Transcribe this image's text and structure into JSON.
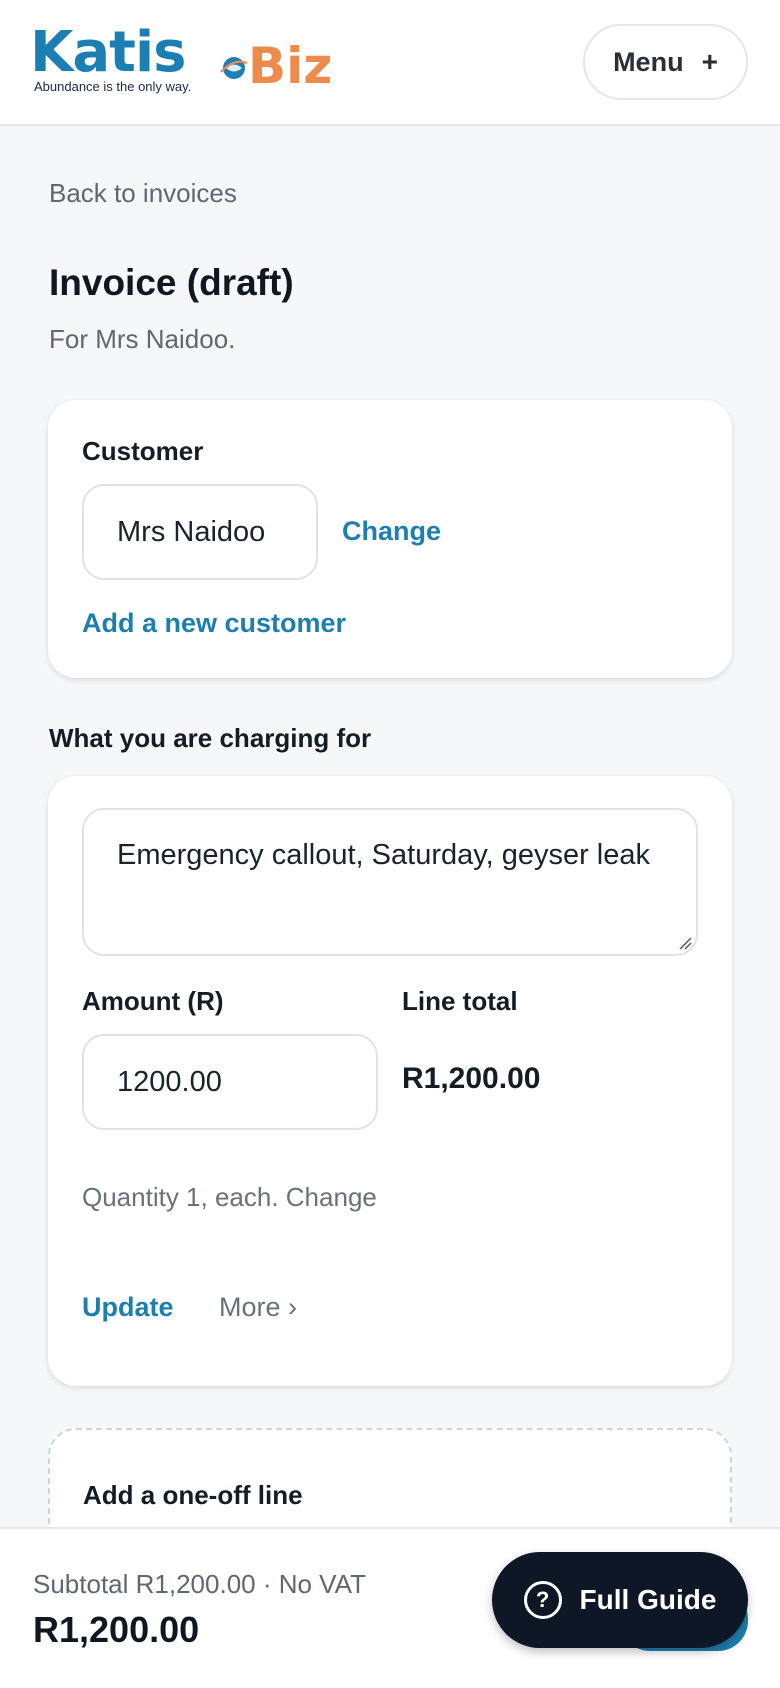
{
  "brand": {
    "name_part1": "Katis",
    "name_part2": "Biz",
    "tagline": "Abundance is the only way.",
    "primary_color": "#1c7fb4",
    "accent_color": "#ee8a4a"
  },
  "header": {
    "menu_label": "Menu",
    "menu_icon": "+"
  },
  "nav": {
    "back_label": "Back to invoices"
  },
  "page": {
    "title": "Invoice (draft)",
    "subtitle": "For Mrs Naidoo."
  },
  "customer": {
    "label": "Customer",
    "value": "Mrs Naidoo",
    "change_label": "Change",
    "add_new_label": "Add a new customer"
  },
  "lines": {
    "heading": "What you are charging for",
    "items": [
      {
        "description": "Emergency callout, Saturday, geyser leak",
        "amount_label": "Amount (R)",
        "amount_value": "1200.00",
        "total_label": "Line total",
        "total_value": "R1,200.00",
        "quantity_text": "Quantity 1, each. Change",
        "update_label": "Update",
        "more_label": "More ›"
      }
    ]
  },
  "oneoff": {
    "heading": "Add a one-off line"
  },
  "summary": {
    "subtotal_text": "Subtotal R1,200.00 · No VAT",
    "total": "R1,200.00"
  },
  "guide": {
    "icon": "?",
    "label": "Full Guide"
  }
}
